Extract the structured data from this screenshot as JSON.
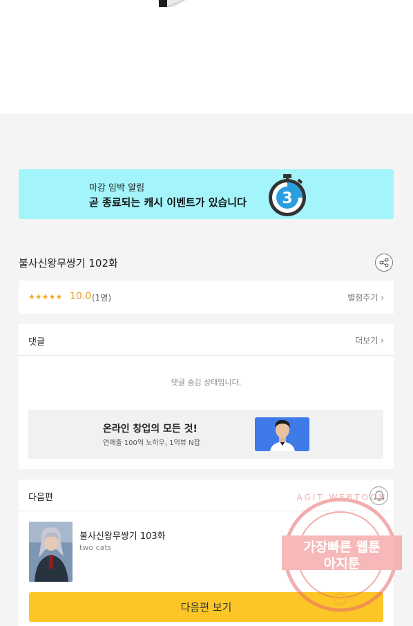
{
  "banner": {
    "subtitle": "마감 임박 알림",
    "title": "곧 종료되는 캐시 이벤트가 있습니다",
    "timer_number": "3",
    "bg_color": "#a3f5fb"
  },
  "episode": {
    "title": "불사신왕무쌍기 102화",
    "share_icon": "share-icon"
  },
  "rating": {
    "stars": "★★★★★",
    "score": "10.0",
    "count": "(1명)",
    "rate_link": "별점주기"
  },
  "comments": {
    "heading": "댓글",
    "more_link": "더보기",
    "hidden_message": "댓글 숨김 상태입니다."
  },
  "ad": {
    "title": "온라인 창업의 모든 것!",
    "subtitle": "연매출 100억 노하우, 1억뷰 N잡"
  },
  "next": {
    "heading": "다음편",
    "bell_icon": "bell-icon",
    "episode_title": "불사신왕무쌍기 103화",
    "author": "two cats",
    "button_label": "다음편 보기",
    "button_color": "#fcc627"
  },
  "watermark": {
    "arc_text": "AGIT WEBTOON",
    "line1": "가장빠른 웹툰",
    "line2": "아지툰"
  }
}
